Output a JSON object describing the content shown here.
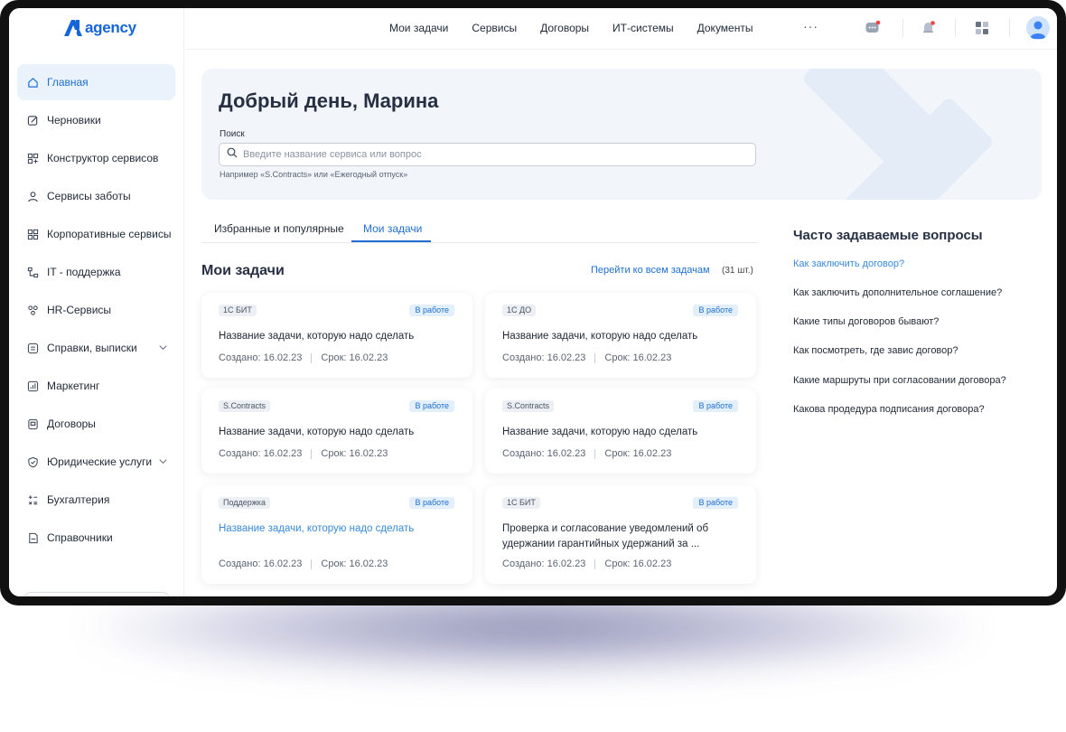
{
  "app": {
    "logo_text": "agency",
    "brand_color": "#1565d8"
  },
  "sidebar": {
    "items": [
      {
        "label": "Главная",
        "icon": "home-icon",
        "active": true
      },
      {
        "label": "Черновики",
        "icon": "edit-icon"
      },
      {
        "label": "Конструктор сервисов",
        "icon": "blocks-icon"
      },
      {
        "label": "Сервисы заботы",
        "icon": "user-icon"
      },
      {
        "label": "Корпоративные сервисы",
        "icon": "grid-icon"
      },
      {
        "label": "IT - поддержка",
        "icon": "network-icon"
      },
      {
        "label": "HR-Сервисы",
        "icon": "people-icon"
      },
      {
        "label": "Справки, выписки",
        "icon": "document-icon",
        "expandable": true
      },
      {
        "label": "Маркетинг",
        "icon": "chart-icon"
      },
      {
        "label": "Договоры",
        "icon": "folder-icon"
      },
      {
        "label": "Юридические услуги",
        "icon": "shield-icon",
        "expandable": true
      },
      {
        "label": "Бухгалтерия",
        "icon": "calculator-icon"
      },
      {
        "label": "Справочники",
        "icon": "book-icon"
      }
    ]
  },
  "topbar": {
    "nav": [
      "Мои задачи",
      "Сервисы",
      "Договоры",
      "ИТ-системы",
      "Документы"
    ],
    "more": "···"
  },
  "hero": {
    "greeting": "Добрый день, Марина",
    "search_label": "Поиск",
    "search_placeholder": "Введите название сервиса или вопрос",
    "search_hint": "Например «S.Contracts» или «Ежегодный отпуск»"
  },
  "tabs": [
    {
      "label": "Избранные и популярные",
      "active": false
    },
    {
      "label": "Мои задачи",
      "active": true
    }
  ],
  "tasks": {
    "title": "Мои задачи",
    "all_link": "Перейти ко всем задачам",
    "count": "(31 шт.)",
    "cards": [
      {
        "tag": "1С БИТ",
        "status": "В работе",
        "title": "Название задачи, которую надо сделать",
        "created": "Создано: 16.02.23",
        "due": "Срок: 16.02.23"
      },
      {
        "tag": "1С ДО",
        "status": "В работе",
        "title": "Название задачи, которую надо сделать",
        "created": "Создано: 16.02.23",
        "due": "Срок: 16.02.23"
      },
      {
        "tag": "S.Contracts",
        "status": "В работе",
        "title": "Название задачи, которую надо сделать",
        "created": "Создано: 16.02.23",
        "due": "Срок: 16.02.23"
      },
      {
        "tag": "S.Contracts",
        "status": "В работе",
        "title": "Название задачи, которую надо сделать",
        "created": "Создано: 16.02.23",
        "due": "Срок: 16.02.23"
      },
      {
        "tag": "Поддержка",
        "status": "В работе",
        "title": "Название задачи, которую надо сделать",
        "created": "Создано: 16.02.23",
        "due": "Срок: 16.02.23",
        "hovered": true
      },
      {
        "tag": "1С БИТ",
        "status": "В работе",
        "title": "Проверка и согласование уведомлений об удержании гарантийных удержаний за  ...",
        "created": "Создано: 16.02.23",
        "due": "Срок: 16.02.23"
      }
    ]
  },
  "faq": {
    "title": "Часто задаваемые вопросы",
    "items": [
      "Как заключить договор?",
      "Как заключить дополнительное соглашение?",
      "Какие типы договоров бывают?",
      "Как посмотреть, где завис договор?",
      "Какие маршруты при согласовании договора?",
      "Какова продедура подписания договора?"
    ]
  },
  "colors": {
    "accent": "#1e6fd0",
    "hero_bg": "#f2f6fb",
    "notification_dot": "#ef4444"
  }
}
